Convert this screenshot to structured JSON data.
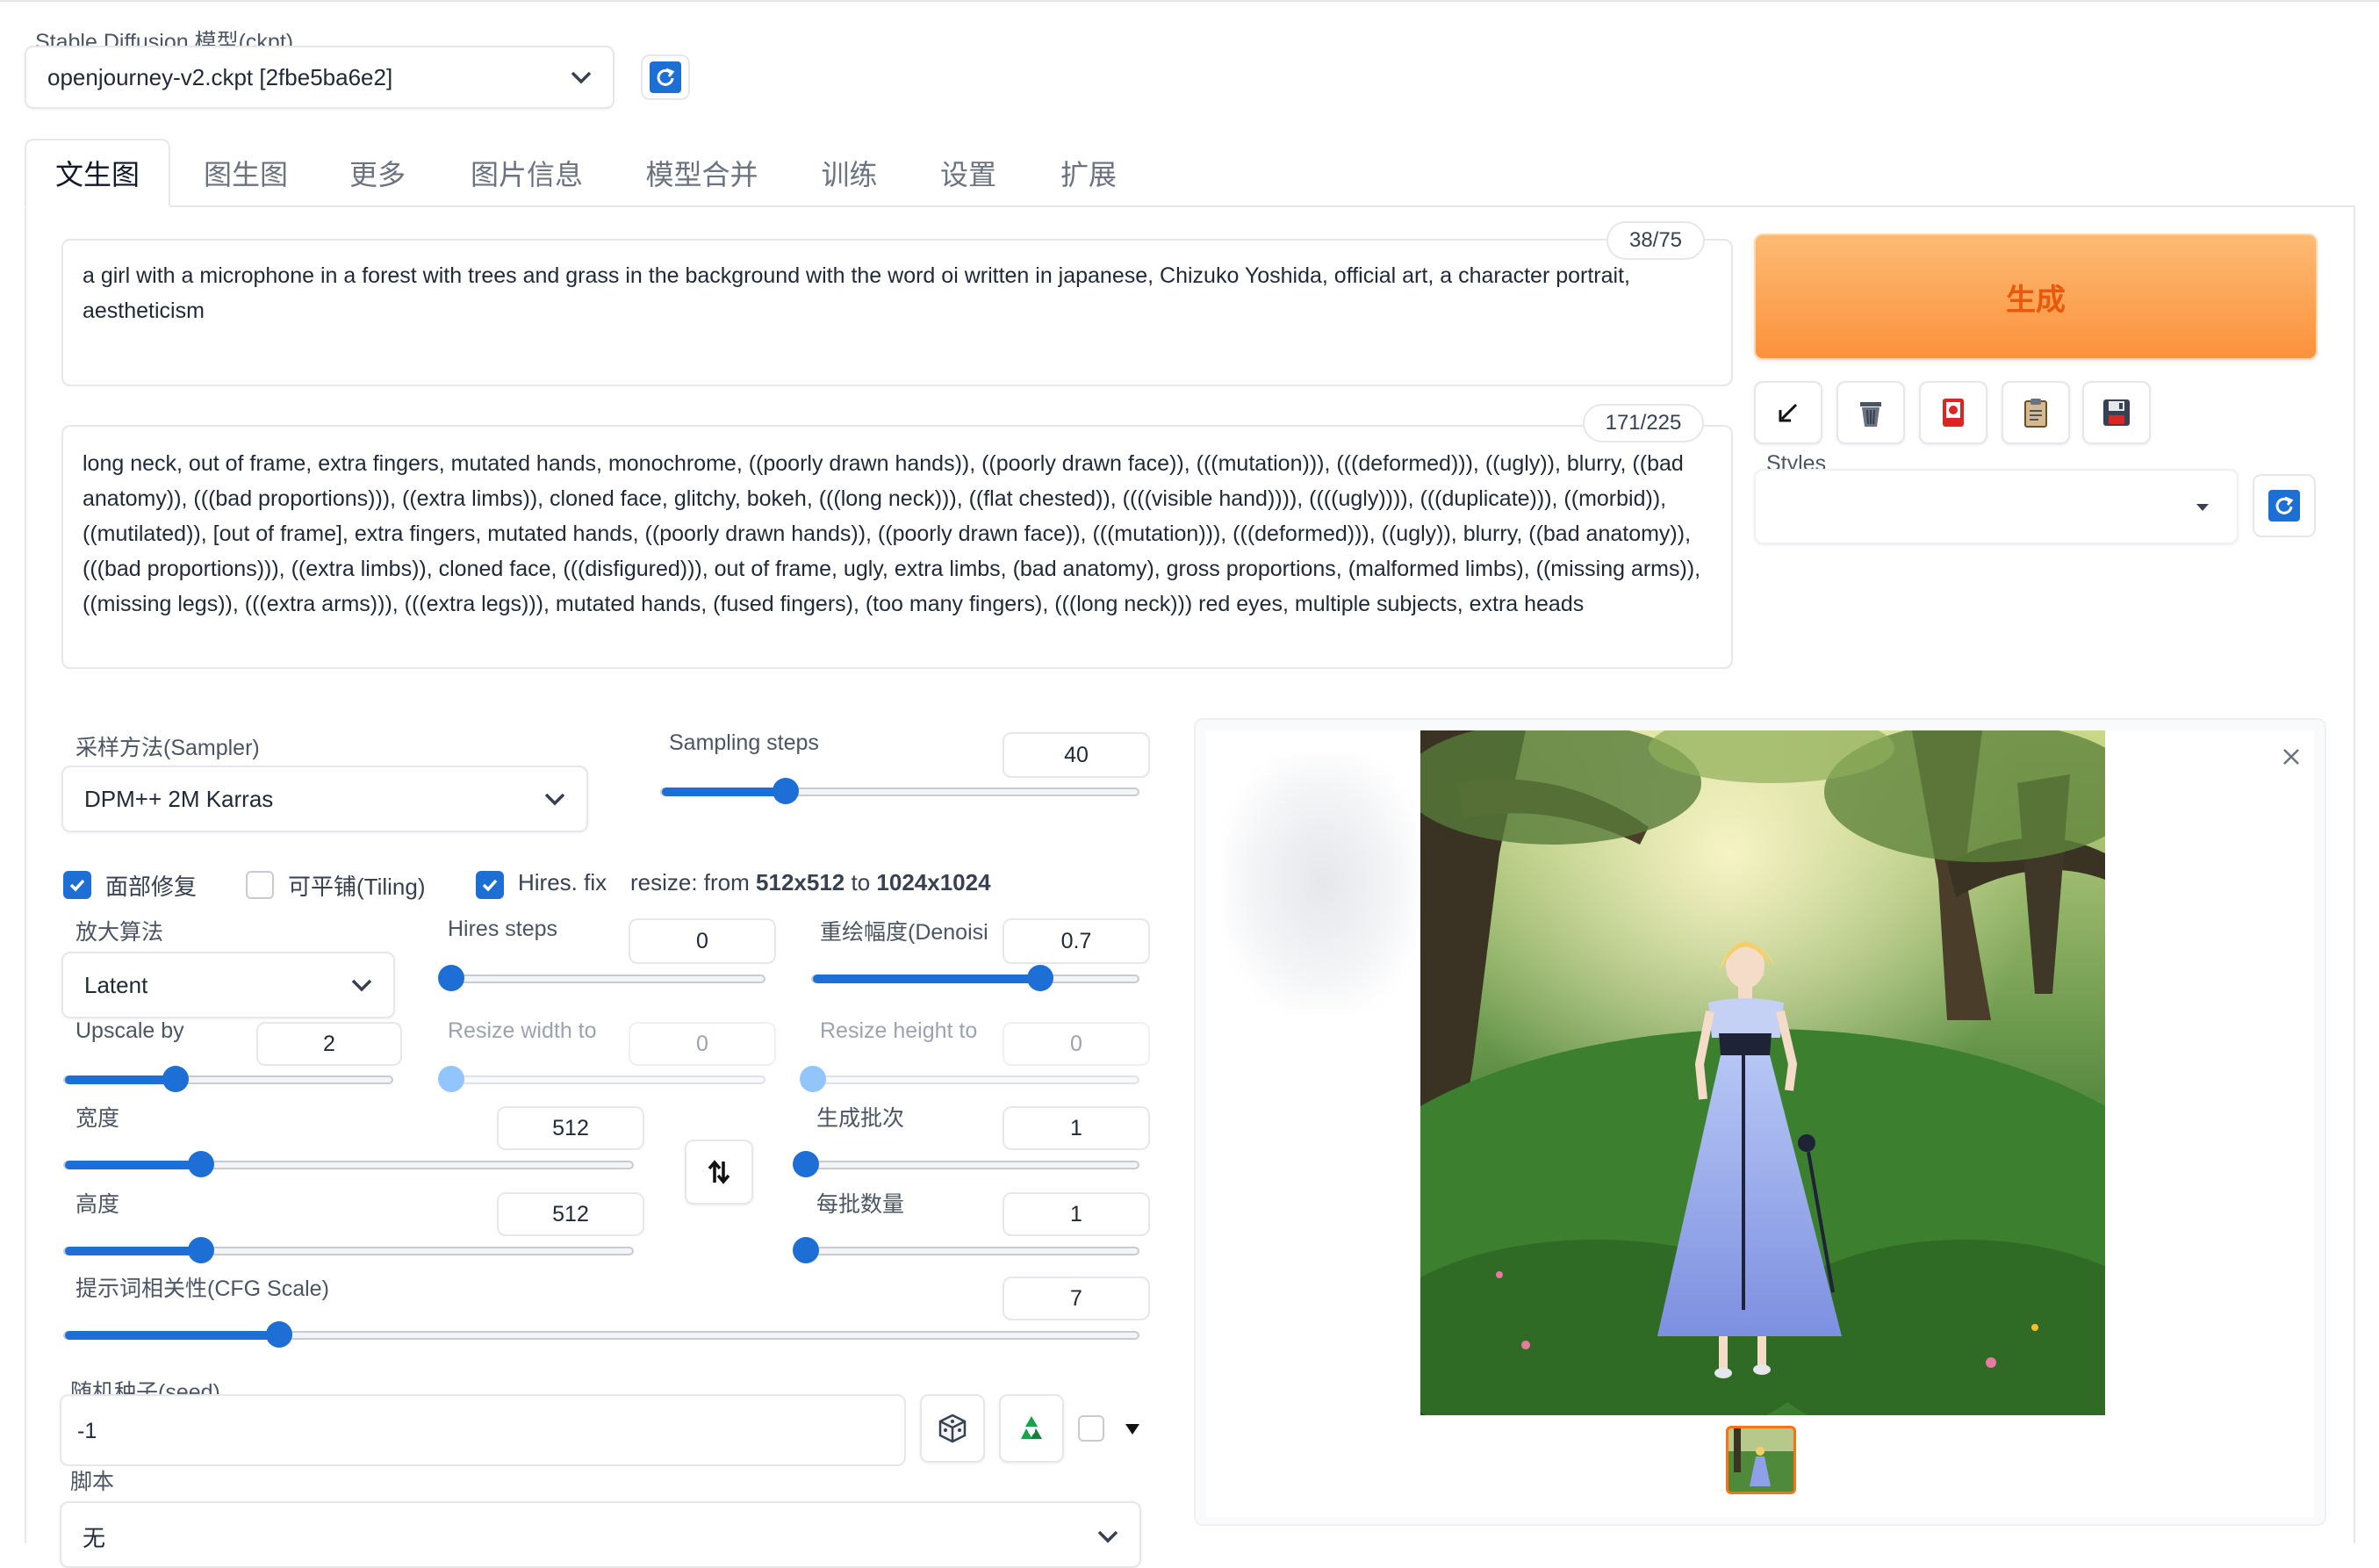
{
  "checkpoint": {
    "label": "Stable Diffusion 模型(ckpt)",
    "value": "openjourney-v2.ckpt [2fbe5ba6e2]",
    "refresh_icon": "refresh-icon"
  },
  "tabs": [
    "文生图",
    "图生图",
    "更多",
    "图片信息",
    "模型合并",
    "训练",
    "设置",
    "扩展"
  ],
  "prompt": {
    "text": "a girl with a microphone in a forest with trees and grass in the background with the word oi written in japanese, Chizuko Yoshida, official art, a character portrait, aestheticism",
    "counter": "38/75"
  },
  "negative_prompt": {
    "text": "long neck, out of frame, extra fingers, mutated hands, monochrome, ((poorly drawn hands)), ((poorly drawn face)), (((mutation))), (((deformed))), ((ugly)), blurry, ((bad anatomy)), (((bad proportions))), ((extra limbs)), cloned face, glitchy, bokeh, (((long neck))), ((flat chested)), ((((visible hand)))), ((((ugly)))), (((duplicate))), ((morbid)), ((mutilated)), [out of frame], extra fingers, mutated hands, ((poorly drawn hands)), ((poorly drawn face)), (((mutation))), (((deformed))), ((ugly)), blurry, ((bad anatomy)), (((bad proportions))), ((extra limbs)), cloned face, (((disfigured))), out of frame, ugly, extra limbs, (bad anatomy), gross proportions, (malformed limbs), ((missing arms)), ((missing legs)), (((extra arms))), (((extra legs))), mutated hands, (fused fingers), (too many fingers), (((long neck))) red eyes, multiple subjects, extra heads",
    "counter": "171/225"
  },
  "generate_label": "生成",
  "tools": [
    "arrow-icon",
    "trash-icon",
    "card-icon",
    "clipboard-icon",
    "save-icon"
  ],
  "styles": {
    "label": "Styles",
    "value": ""
  },
  "sampler": {
    "label": "采样方法(Sampler)",
    "value": "DPM++ 2M Karras"
  },
  "steps": {
    "label": "Sampling steps",
    "value": "40",
    "fraction": 0.26
  },
  "checkboxes": {
    "face_label": "面部修复",
    "face": true,
    "tiling_label": "可平铺(Tiling)",
    "tiling": false,
    "hires_label": "Hires. fix",
    "hires": true
  },
  "resize_info": {
    "prefix": "resize: from ",
    "from": "512x512",
    "middle": " to ",
    "to": "1024x1024"
  },
  "upscaler": {
    "label": "放大算法",
    "value": "Latent"
  },
  "hires_steps": {
    "label": "Hires steps",
    "value": "0",
    "fraction": 0.0
  },
  "denoise": {
    "label": "重绘幅度(Denoisi",
    "value": "0.7",
    "fraction": 0.7
  },
  "upscale_by": {
    "label": "Upscale by",
    "value": "2",
    "fraction": 0.34
  },
  "resize_width": {
    "label": "Resize width to",
    "value": "0",
    "fraction": 0.0
  },
  "resize_height": {
    "label": "Resize height to",
    "value": "0",
    "fraction": 0.0
  },
  "width": {
    "label": "宽度",
    "value": "512",
    "fraction": 0.24
  },
  "height": {
    "label": "高度",
    "value": "512",
    "fraction": 0.24
  },
  "batch_count": {
    "label": "生成批次",
    "value": "1",
    "fraction": 0.0
  },
  "batch_size": {
    "label": "每批数量",
    "value": "1",
    "fraction": 0.0
  },
  "cfg": {
    "label": "提示词相关性(CFG Scale)",
    "value": "7",
    "fraction": 0.2
  },
  "seed": {
    "label": "随机种子(seed)",
    "value": "-1"
  },
  "script": {
    "label": "脚本",
    "value": "无"
  },
  "colors": {
    "accent": "#1d6fd6",
    "generate": "#fb923c",
    "generate_text": "#ea580c"
  }
}
